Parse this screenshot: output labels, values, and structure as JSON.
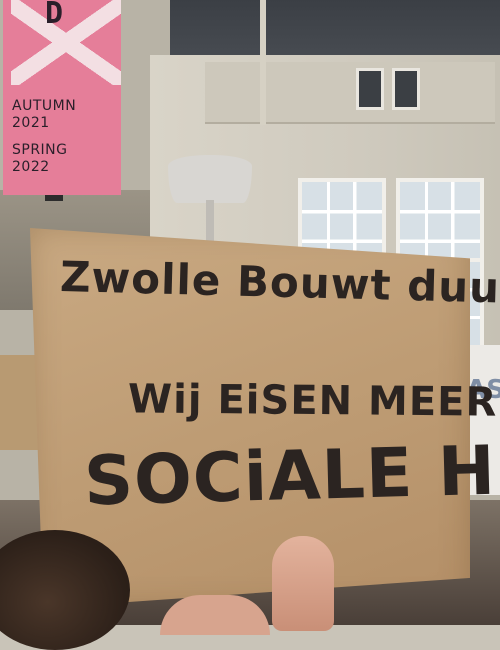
{
  "banner": {
    "letter": "D",
    "line1": "AUTUMN",
    "line2": "2021",
    "line3": "SPRING",
    "line4": "2022",
    "color": "#e57e99"
  },
  "sign": {
    "line1": "Zwolle Bouwt duur",
    "line2": "Wij EiSEN  MEER",
    "line3": "SOCiALE HUUR",
    "color": "#c9a982",
    "ink": "#2b2421"
  },
  "side_sign": {
    "text": "AAS"
  }
}
